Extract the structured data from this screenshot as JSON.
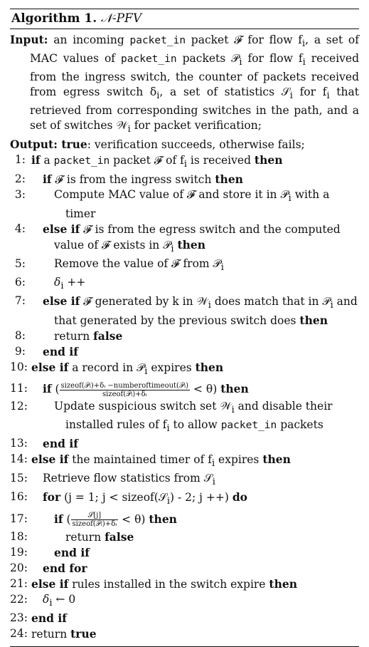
{
  "algorithm": {
    "label": "Algorithm 1.",
    "name": "𝒩-PFV",
    "input_label": "Input:",
    "input_text_1": " an incoming ",
    "input_code_1": "packet_in",
    "input_text_2": " packet 𝓕 for flow f",
    "input_sub_1": "i",
    "input_text_3": ", a set of MAC values of ",
    "input_code_2": "packet_in",
    "input_text_4": " packets 𝒫",
    "input_sub_2": "i",
    "input_text_5": " for flow f",
    "input_sub_3": "i",
    "input_text_6": " received from the ingress switch, the counter of packets received from egress switch δ",
    "input_sub_4": "i",
    "input_text_7": ", a set of statistics 𝒮",
    "input_sub_5": "i",
    "input_text_8": " for f",
    "input_sub_6": "i",
    "input_text_9": " that retrieved from corresponding switches in the path, and a set of switches 𝒲",
    "input_sub_7": "i",
    "input_text_10": " for packet verification;",
    "output_label": "Output: true",
    "output_text": ": verification succeeds, otherwise fails;"
  },
  "lines": [
    {
      "n": "1:",
      "html_key": "l1"
    },
    {
      "n": "2:",
      "html_key": "l2"
    }
  ],
  "l": {
    "n1": "1:",
    "n2": "2:",
    "n3": "3:",
    "n4": "4:",
    "n5": "5:",
    "n6": "6:",
    "n7": "7:",
    "n8": "8:",
    "n9": "9:",
    "n10": "10:",
    "n11": "11:",
    "n12": "12:",
    "n13": "13:",
    "n14": "14:",
    "n15": "15:",
    "n16": "16:",
    "n17": "17:",
    "n18": "18:",
    "n19": "19:",
    "n20": "20:",
    "n21": "21:",
    "n22": "22:",
    "n23": "23:",
    "n24": "24:",
    "if": "if",
    "then": "then",
    "else_if": "else if",
    "end_if": "end if",
    "end_for": "end for",
    "for": "for",
    "do": "do",
    "false": "false",
    "true": "true",
    "return": "return",
    "t1a": " a ",
    "t1code": "packet_in",
    "t1b": " packet 𝓕 of f",
    "t1sub": "i",
    "t1c": " is received ",
    "t2": " 𝓕 is from the ingress switch ",
    "t3a": "Compute MAC value of 𝓕 and store it in 𝒫",
    "t3sub": "i",
    "t3b": " with a timer",
    "t4a": " 𝓕 is from the egress switch and the computed value of 𝓕 exists in 𝒫",
    "t4sub": "i",
    "t4b": " ",
    "t5a": "Remove the value of 𝓕 from 𝒫",
    "t5sub": "i",
    "t6a": "δ",
    "t6sub": "i",
    "t6b": " ++",
    "t7a": " 𝓕 generated by k in 𝒲",
    "t7sub1": "i",
    "t7b": " does match that in 𝒫",
    "t7sub2": "i",
    "t7c": " and that generated by the previous switch does ",
    "t8": "return ",
    "t10a": " a record in 𝒫",
    "t10sub": "i",
    "t10b": " expires ",
    "t11open": " (",
    "t11num": "sizeof(𝒫ᵢ)+δᵢ −numberoftimeout(𝒫ᵢ)",
    "t11den": "sizeof(𝒫ᵢ)+δᵢ",
    "t11close": " < θ) ",
    "t12a": "Update suspicious switch set 𝒲",
    "t12sub1": "i",
    "t12b": " and disable their installed rules of f",
    "t12sub2": "i",
    "t12c": " to allow ",
    "t12code": "packet_in",
    "t12d": " packets",
    "t14a": " the maintained timer of f",
    "t14sub": "i",
    "t14b": " expires ",
    "t15a": "Retrieve flow statistics from 𝒮",
    "t15sub": "i",
    "t16a": " (j = 1; j < sizeof(𝒮",
    "t16sub": "i",
    "t16b": ") - 2; j ++) ",
    "t17open": " (",
    "t17num": "𝒮[j]",
    "t17den": "sizeof(𝒫ᵢ)+δᵢ",
    "t17close": " < θ) ",
    "t18": "return ",
    "t21": " rules installed in the switch expire ",
    "t22a": "δ",
    "t22sub": "i",
    "t22b": " ← 0",
    "t24": "return "
  }
}
